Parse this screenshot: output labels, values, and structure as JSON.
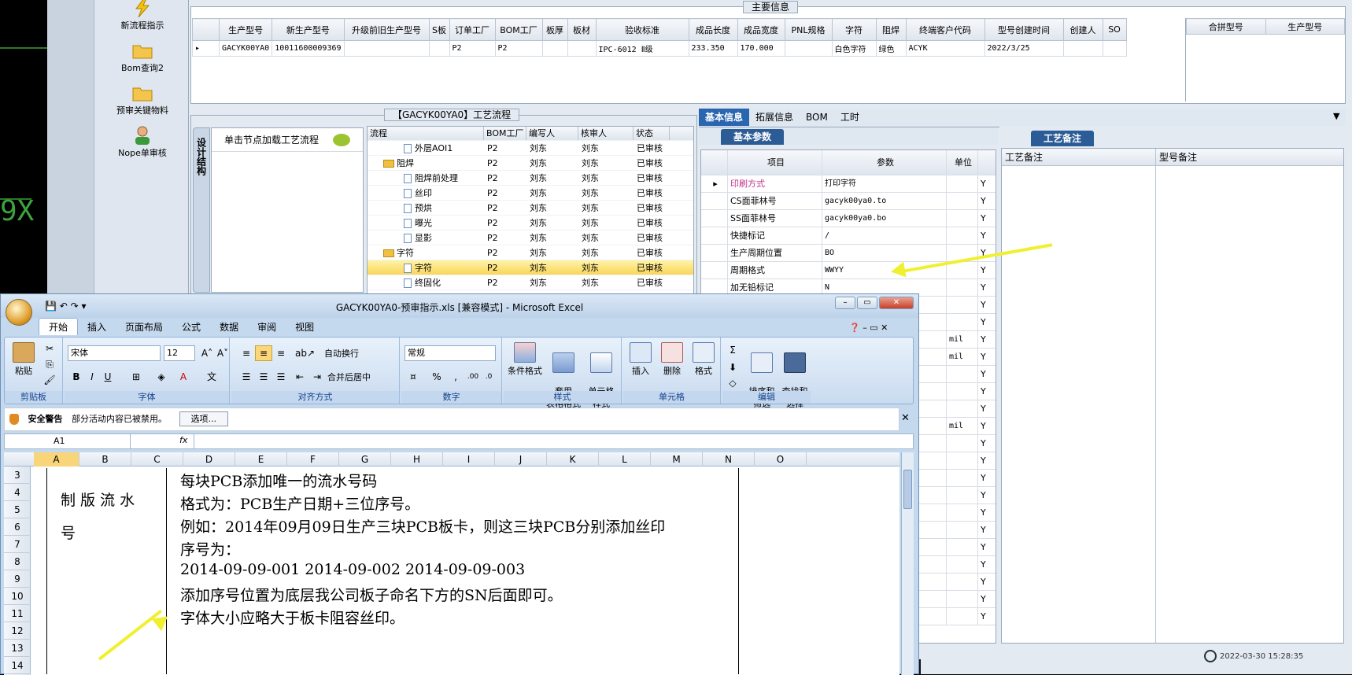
{
  "nav": {
    "items": [
      {
        "label": "新流程指示",
        "icon": "lightning-icon"
      },
      {
        "label": "Bom查询2",
        "icon": "folder-icon"
      },
      {
        "label": "预审关键物料",
        "icon": "folder-icon"
      },
      {
        "label": "Nope单审核",
        "icon": "user-icon"
      }
    ]
  },
  "main": {
    "title": "主要信息",
    "headers": [
      "生产型号",
      "新生产型号",
      "升级前旧生产型号",
      "S板",
      "订单工厂",
      "BOM工厂",
      "板厚",
      "板材",
      "验收标准",
      "成品长度",
      "成品宽度",
      "PNL规格",
      "字符",
      "阻焊",
      "终端客户代码",
      "型号创建时间",
      "创建人",
      "SO"
    ],
    "row": [
      "GACYK00YA0",
      "10011600009369",
      "",
      "",
      "P2",
      "P2",
      "",
      "",
      "IPC-6012 Ⅱ级",
      "233.350",
      "170.000",
      "",
      "白色字符",
      "绿色",
      "ACYK",
      "2022/3/25",
      "",
      ""
    ],
    "side_headers": [
      "合拼型号",
      "生产型号"
    ]
  },
  "process": {
    "title": "【GACYK00YA0】工艺流程",
    "side_tab": "设计结构",
    "load_hint": "单击节点加载工艺流程",
    "headers": [
      "流程",
      "BOM工厂",
      "编写人",
      "核审人",
      "状态"
    ],
    "rows": [
      {
        "name": "外层AOI1",
        "level": 2,
        "type": "doc",
        "bom": "P2",
        "writer": "刘东",
        "reviewer": "刘东",
        "status": "已审核"
      },
      {
        "name": "阻焊",
        "level": 1,
        "type": "folder",
        "bom": "P2",
        "writer": "刘东",
        "reviewer": "刘东",
        "status": "已审核"
      },
      {
        "name": "阻焊前处理",
        "level": 2,
        "type": "doc",
        "bom": "P2",
        "writer": "刘东",
        "reviewer": "刘东",
        "status": "已审核"
      },
      {
        "name": "丝印",
        "level": 2,
        "type": "doc",
        "bom": "P2",
        "writer": "刘东",
        "reviewer": "刘东",
        "status": "已审核"
      },
      {
        "name": "预烘",
        "level": 2,
        "type": "doc",
        "bom": "P2",
        "writer": "刘东",
        "reviewer": "刘东",
        "status": "已审核"
      },
      {
        "name": "曝光",
        "level": 2,
        "type": "doc",
        "bom": "P2",
        "writer": "刘东",
        "reviewer": "刘东",
        "status": "已审核"
      },
      {
        "name": "显影",
        "level": 2,
        "type": "doc",
        "bom": "P2",
        "writer": "刘东",
        "reviewer": "刘东",
        "status": "已审核"
      },
      {
        "name": "字符",
        "level": 1,
        "type": "folder",
        "bom": "P2",
        "writer": "刘东",
        "reviewer": "刘东",
        "status": "已审核"
      },
      {
        "name": "字符",
        "level": 2,
        "type": "doc",
        "bom": "P2",
        "writer": "刘东",
        "reviewer": "刘东",
        "status": "已审核",
        "selected": true
      },
      {
        "name": "终固化",
        "level": 2,
        "type": "doc",
        "bom": "P2",
        "writer": "刘东",
        "reviewer": "刘东",
        "status": "已审核"
      }
    ]
  },
  "info": {
    "tabs": [
      "基本信息",
      "拓展信息",
      "BOM",
      "工时"
    ],
    "sub_tab": "基本参数",
    "headers": [
      "项目",
      "参数",
      "单位"
    ],
    "rows": [
      {
        "item": "印刷方式",
        "param": "打印字符",
        "unit": "",
        "flag": "Y",
        "highlight": true
      },
      {
        "item": "CS面菲林号",
        "param": "gacyk00ya0.to",
        "unit": "",
        "flag": "Y"
      },
      {
        "item": "SS面菲林号",
        "param": "gacyk00ya0.bo",
        "unit": "",
        "flag": "Y"
      },
      {
        "item": "快捷标记",
        "param": "/",
        "unit": "",
        "flag": "Y"
      },
      {
        "item": "生产周期位置",
        "param": "BO",
        "unit": "",
        "flag": "Y"
      },
      {
        "item": "周期格式",
        "param": "WWYY",
        "unit": "",
        "flag": "Y"
      },
      {
        "item": "加无铅标记",
        "param": "N",
        "unit": "",
        "flag": "Y"
      }
    ],
    "units_visible": [
      "",
      "",
      "",
      "",
      "",
      "",
      "",
      "",
      "",
      "mil",
      "mil",
      "",
      "",
      "",
      "mil",
      "",
      "",
      "",
      "",
      "",
      "",
      "",
      "",
      "",
      "",
      ""
    ],
    "flags": "Y"
  },
  "remarks": {
    "tab": "工艺备注",
    "headers": [
      "工艺备注",
      "型号备注"
    ]
  },
  "status": {
    "datetime": "2022-03-30 15:28:35"
  },
  "excel": {
    "title": "GACYK00YA0-预审指示.xls  [兼容模式] - Microsoft Excel",
    "tabs": [
      "开始",
      "插入",
      "页面布局",
      "公式",
      "数据",
      "审阅",
      "视图"
    ],
    "ribbon": {
      "paste": "粘贴",
      "clipboard": "剪贴板",
      "font_name": "宋体",
      "font_size": "12",
      "font_group": "字体",
      "wrap": "自动换行",
      "merge": "合并后居中",
      "align_group": "对齐方式",
      "number_format": "常规",
      "number_group": "数字",
      "cond_format": "条件格式",
      "table_format": "套用\n表格格式",
      "cell_style": "单元格\n样式",
      "style_group": "样式",
      "insert": "插入",
      "delete": "删除",
      "format": "格式",
      "cells_group": "单元格",
      "sort": "排序和\n筛选",
      "find": "查找和\n选择",
      "edit_group": "编辑"
    },
    "security": {
      "label": "安全警告",
      "message": "部分活动内容已被禁用。",
      "button": "选项..."
    },
    "namebox": "A1",
    "fx": "fx",
    "columns": [
      "A",
      "B",
      "C",
      "D",
      "E",
      "F",
      "G",
      "H",
      "I",
      "J",
      "K",
      "L",
      "M",
      "N",
      "O"
    ],
    "rows": [
      "3",
      "4",
      "5",
      "6",
      "7",
      "8",
      "9",
      "10",
      "11",
      "12",
      "13",
      "14"
    ],
    "cell_label": "制 版 流 水\n号",
    "content_lines": [
      "每块PCB添加唯一的流水号码",
      "格式为：PCB生产日期+三位序号。",
      "例如：2014年09月09日生产三块PCB板卡，则这三块PCB分别添加丝印",
      "序号为：",
      "2014-09-09-001    2014-09-002   2014-09-09-003",
      "添加序号位置为底层我公司板子命名下方的SN后面即可。",
      "字体大小应略大于板卡阻容丝印。"
    ]
  }
}
